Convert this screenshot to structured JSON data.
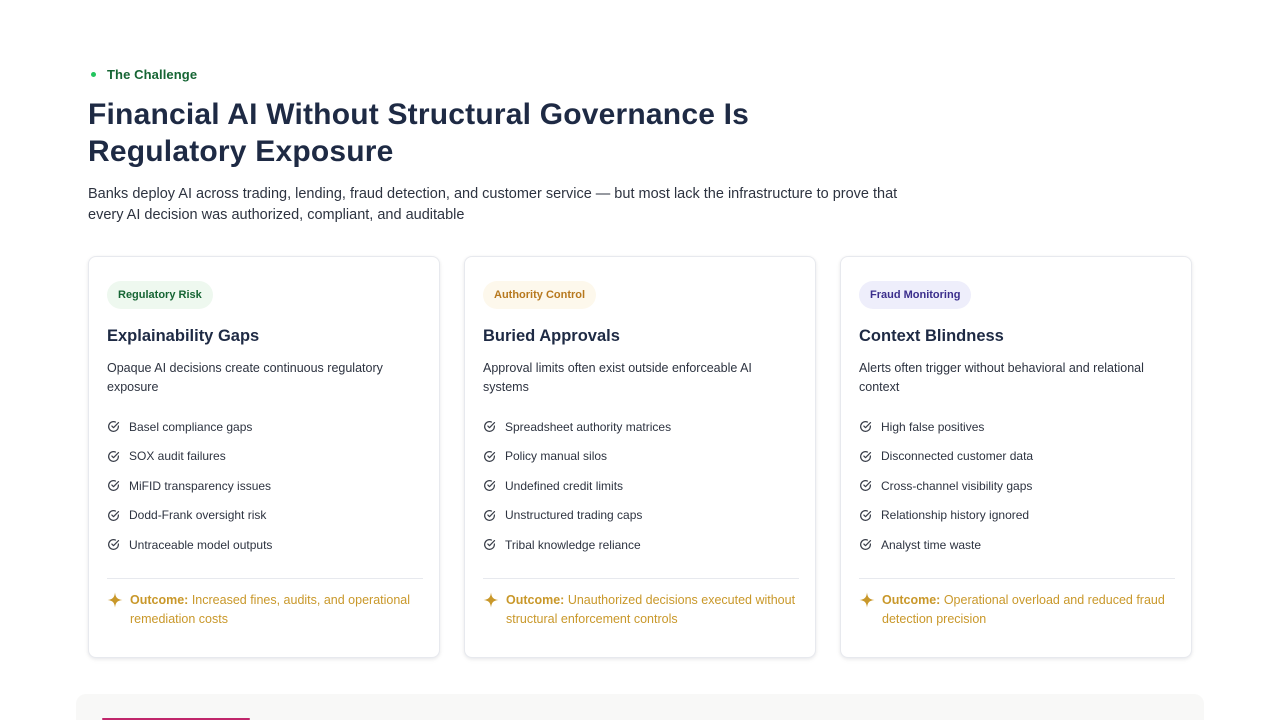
{
  "eyebrow": {
    "label": "The Challenge",
    "dot_color": "#22c55e"
  },
  "title": "Financial AI Without Structural Governance Is Regulatory Exposure",
  "subtitle": "Banks deploy AI across trading, lending, fraud detection, and customer service — but most lack the infrastructure to prove that every AI decision was authorized, compliant, and auditable",
  "cards": [
    {
      "badge": "Regulatory Risk",
      "badge_color": "#166534",
      "title": "Explainability Gaps",
      "description": "Opaque AI decisions create continuous regulatory exposure",
      "items": [
        "Basel compliance gaps",
        "SOX audit failures",
        "MiFID transparency issues",
        "Dodd-Frank oversight risk",
        "Untraceable model outputs"
      ],
      "outcome_label": "Outcome:",
      "outcome_text": "Increased fines, audits, and operational remediation costs"
    },
    {
      "badge": "Authority Control",
      "badge_color": "#b7791f",
      "title": "Buried Approvals",
      "description": "Approval limits often exist outside enforceable AI systems",
      "items": [
        "Spreadsheet authority matrices",
        "Policy manual silos",
        "Undefined credit limits",
        "Unstructured trading caps",
        "Tribal knowledge reliance"
      ],
      "outcome_label": "Outcome:",
      "outcome_text": "Unauthorized decisions executed without structural enforcement controls"
    },
    {
      "badge": "Fraud Monitoring",
      "badge_color": "#3b2e8c",
      "title": "Context Blindness",
      "description": "Alerts often trigger without behavioral and relational context",
      "items": [
        "High false positives",
        "Disconnected customer data",
        "Cross-channel visibility gaps",
        "Relationship history ignored",
        "Analyst time waste"
      ],
      "outcome_label": "Outcome:",
      "outcome_text": "Operational overload and reduced fraud detection precision"
    }
  ],
  "icons": {
    "check": "check-circle-icon",
    "outcome": "sparkle-icon"
  },
  "colors": {
    "heading": "#1e2a44",
    "outcome": "#c9982a",
    "accent_green": "#166534"
  }
}
